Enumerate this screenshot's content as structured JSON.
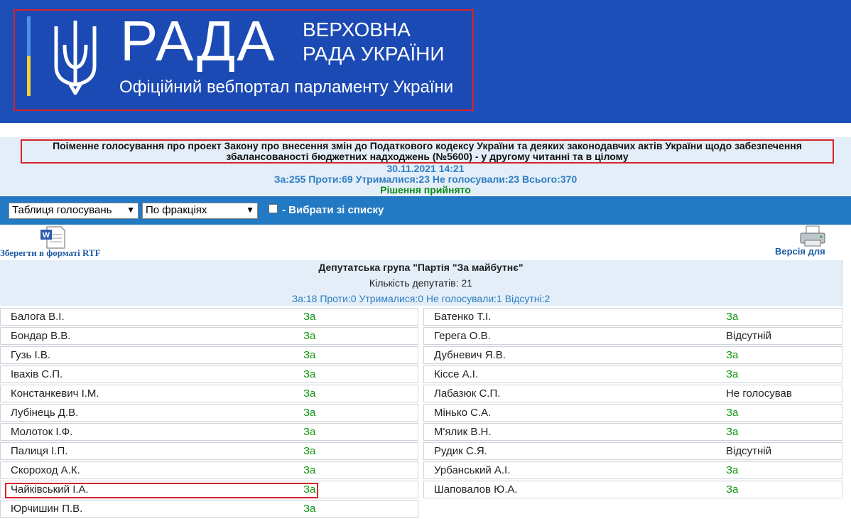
{
  "header": {
    "logo_word": "РАДА",
    "logo_line1": "ВЕРХОВНА",
    "logo_line2": "РАДА УКРАЇНИ",
    "portal": "Офіційний вебпортал парламенту України"
  },
  "vote": {
    "title": "Поіменне голосування про проект Закону про внесення змін до Податкового кодексу України та деяких законодавчих актів України щодо забезпечення збалансованості бюджетних надходжень (№5600) - у другому читанні та в цілому",
    "date": "30.11.2021 14:21",
    "totals": "За:255 Проти:69 Утрималися:23 Не голосували:23 Всього:370",
    "result": "Рішення прийнято"
  },
  "toolbar": {
    "view_select": "Таблиця голосувань",
    "group_select": "По фракціях",
    "choose_label": "- Вибрати зі списку"
  },
  "export": {
    "rtf": "Зберегти в форматі RTF",
    "print": "Версія для друку"
  },
  "faction": {
    "name": "Депутатська група \"Партія \"За майбутнє\"",
    "count": "Кількість депутатів: 21",
    "stats": "За:18 Проти:0 Утрималися:0 Не голосували:1 Відсутні:2"
  },
  "deputies_left": [
    {
      "name": "Балога В.І.",
      "vote": "За"
    },
    {
      "name": "Бондар В.В.",
      "vote": "За"
    },
    {
      "name": "Гузь І.В.",
      "vote": "За"
    },
    {
      "name": "Івахів С.П.",
      "vote": "За"
    },
    {
      "name": "Констанкевич І.М.",
      "vote": "За"
    },
    {
      "name": "Лубінець Д.В.",
      "vote": "За"
    },
    {
      "name": "Молоток І.Ф.",
      "vote": "За"
    },
    {
      "name": "Палиця І.П.",
      "vote": "За"
    },
    {
      "name": "Скороход А.К.",
      "vote": "За"
    },
    {
      "name": "Чайківський І.А.",
      "vote": "За"
    },
    {
      "name": "Юрчишин П.В.",
      "vote": "За"
    }
  ],
  "deputies_right": [
    {
      "name": "Батенко Т.І.",
      "vote": "За"
    },
    {
      "name": "Герега О.В.",
      "vote": "Відсутній"
    },
    {
      "name": "Дубневич Я.В.",
      "vote": "За"
    },
    {
      "name": "Кіссе А.І.",
      "vote": "За"
    },
    {
      "name": "Лабазюк С.П.",
      "vote": "Не голосував"
    },
    {
      "name": "Мінько С.А.",
      "vote": "За"
    },
    {
      "name": "М'ялик В.Н.",
      "vote": "За"
    },
    {
      "name": "Рудик С.Я.",
      "vote": "Відсутній"
    },
    {
      "name": "Урбанський А.І.",
      "vote": "За"
    },
    {
      "name": "Шаповалов Ю.А.",
      "vote": "За"
    }
  ],
  "colors": {
    "header_blue": "#1d4fb8",
    "toolbar_blue": "#2279c4",
    "vote_for_green": "#12950f",
    "highlight_red": "#d8232a"
  }
}
